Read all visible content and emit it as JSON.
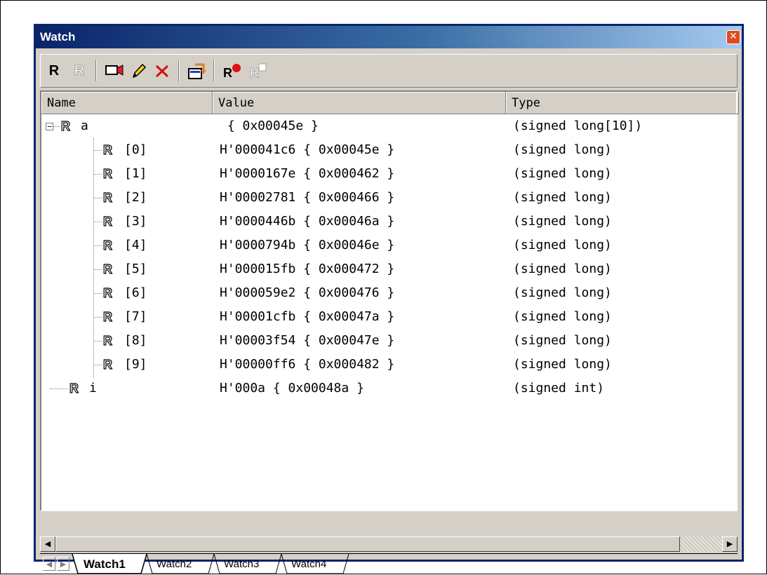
{
  "window": {
    "title": "Watch",
    "close_glyph": "✕"
  },
  "toolbar": {
    "icons": [
      "register-r-icon",
      "register-r-disabled-icon",
      "add-watch-icon",
      "edit-icon",
      "delete-icon",
      "refresh-icon",
      "breakpoint-icon",
      "radix-disabled-icon"
    ],
    "r_label": "R"
  },
  "columns": {
    "name": "Name",
    "value": "Value",
    "type": "Type"
  },
  "rows": [
    {
      "name": "a",
      "value": " { 0x00045e }",
      "type": "(signed long[10])"
    },
    {
      "name": "[0]",
      "value": "H'000041c6 { 0x00045e }",
      "type": "(signed long)"
    },
    {
      "name": "[1]",
      "value": "H'0000167e { 0x000462 }",
      "type": "(signed long)"
    },
    {
      "name": "[2]",
      "value": "H'00002781 { 0x000466 }",
      "type": "(signed long)"
    },
    {
      "name": "[3]",
      "value": "H'0000446b { 0x00046a }",
      "type": "(signed long)"
    },
    {
      "name": "[4]",
      "value": "H'0000794b { 0x00046e }",
      "type": "(signed long)"
    },
    {
      "name": "[5]",
      "value": "H'000015fb { 0x000472 }",
      "type": "(signed long)"
    },
    {
      "name": "[6]",
      "value": "H'000059e2 { 0x000476 }",
      "type": "(signed long)"
    },
    {
      "name": "[7]",
      "value": "H'00001cfb { 0x00047a }",
      "type": "(signed long)"
    },
    {
      "name": "[8]",
      "value": "H'00003f54 { 0x00047e }",
      "type": "(signed long)"
    },
    {
      "name": "[9]",
      "value": "H'00000ff6 { 0x000482 }",
      "type": "(signed long)"
    },
    {
      "name": "i",
      "value": "H'000a { 0x00048a }",
      "type": "(signed int)"
    }
  ],
  "expander_glyph": "−",
  "register_glyph": "R",
  "tabs": [
    "Watch1",
    "Watch2",
    "Watch3",
    "Watch4"
  ],
  "active_tab": "Watch1"
}
